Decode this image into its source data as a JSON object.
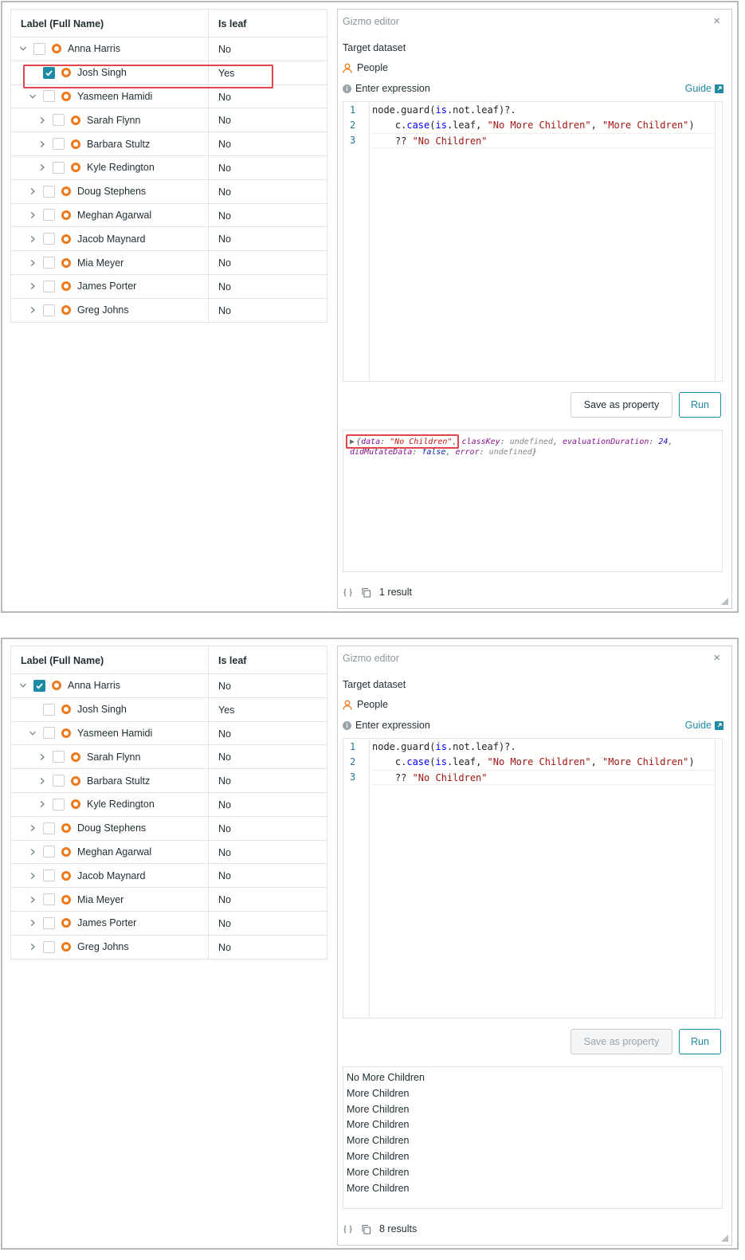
{
  "table": {
    "col_label": "Label (Full Name)",
    "col_leaf": "Is leaf"
  },
  "shot1": {
    "rows": [
      {
        "label": "Anna Harris",
        "leaf": "No",
        "level": 0,
        "chev": "down",
        "checked": false
      },
      {
        "label": "Josh Singh",
        "leaf": "Yes",
        "level": 1,
        "chev": "none",
        "checked": true
      },
      {
        "label": "Yasmeen Hamidi",
        "leaf": "No",
        "level": 1,
        "chev": "down",
        "checked": false
      },
      {
        "label": "Sarah Flynn",
        "leaf": "No",
        "level": 2,
        "chev": "right",
        "checked": false
      },
      {
        "label": "Barbara Stultz",
        "leaf": "No",
        "level": 2,
        "chev": "right",
        "checked": false
      },
      {
        "label": "Kyle Redington",
        "leaf": "No",
        "level": 2,
        "chev": "right",
        "checked": false
      },
      {
        "label": "Doug Stephens",
        "leaf": "No",
        "level": 1,
        "chev": "right",
        "checked": false
      },
      {
        "label": "Meghan Agarwal",
        "leaf": "No",
        "level": 1,
        "chev": "right",
        "checked": false
      },
      {
        "label": "Jacob Maynard",
        "leaf": "No",
        "level": 1,
        "chev": "right",
        "checked": false
      },
      {
        "label": "Mia Meyer",
        "leaf": "No",
        "level": 1,
        "chev": "right",
        "checked": false
      },
      {
        "label": "James Porter",
        "leaf": "No",
        "level": 1,
        "chev": "right",
        "checked": false
      },
      {
        "label": "Greg Johns",
        "leaf": "No",
        "level": 1,
        "chev": "right",
        "checked": false
      }
    ],
    "console": {
      "open": "{",
      "data_key": "data",
      "data_val": "\"No Children\"",
      "classkey_key": "classKey",
      "classkey_val": "undefined",
      "dur_key": "evaluationDuration",
      "dur_val": "24",
      "mut_key": "didMutateData",
      "mut_val": "false",
      "err_key": "error",
      "err_val": "undefined",
      "close": "}"
    },
    "result_count": "1 result"
  },
  "shot2": {
    "rows": [
      {
        "label": "Anna Harris",
        "leaf": "No",
        "level": 0,
        "chev": "down",
        "checked": true
      },
      {
        "label": "Josh Singh",
        "leaf": "Yes",
        "level": 1,
        "chev": "none",
        "checked": false
      },
      {
        "label": "Yasmeen Hamidi",
        "leaf": "No",
        "level": 1,
        "chev": "down",
        "checked": false
      },
      {
        "label": "Sarah Flynn",
        "leaf": "No",
        "level": 2,
        "chev": "right",
        "checked": false
      },
      {
        "label": "Barbara Stultz",
        "leaf": "No",
        "level": 2,
        "chev": "right",
        "checked": false
      },
      {
        "label": "Kyle Redington",
        "leaf": "No",
        "level": 2,
        "chev": "right",
        "checked": false
      },
      {
        "label": "Doug Stephens",
        "leaf": "No",
        "level": 1,
        "chev": "right",
        "checked": false
      },
      {
        "label": "Meghan Agarwal",
        "leaf": "No",
        "level": 1,
        "chev": "right",
        "checked": false
      },
      {
        "label": "Jacob Maynard",
        "leaf": "No",
        "level": 1,
        "chev": "right",
        "checked": false
      },
      {
        "label": "Mia Meyer",
        "leaf": "No",
        "level": 1,
        "chev": "right",
        "checked": false
      },
      {
        "label": "James Porter",
        "leaf": "No",
        "level": 1,
        "chev": "right",
        "checked": false
      },
      {
        "label": "Greg Johns",
        "leaf": "No",
        "level": 1,
        "chev": "right",
        "checked": false
      }
    ],
    "results": [
      "No More Children",
      "More Children",
      "More Children",
      "More Children",
      "More Children",
      "More Children",
      "More Children",
      "More Children"
    ],
    "result_count": "8 results"
  },
  "editor": {
    "title": "Gizmo editor",
    "close_glyph": "×",
    "target_label": "Target dataset",
    "dataset": "People",
    "expr_label": "Enter expression",
    "info_glyph": "i",
    "guide": "Guide",
    "line_numbers": [
      "1",
      "2",
      "3"
    ],
    "code": [
      [
        {
          "t": "node.guard(",
          "c": ""
        },
        {
          "t": "is",
          "c": "kw"
        },
        {
          "t": ".not.leaf)?.",
          "c": ""
        }
      ],
      [
        {
          "t": "    c.",
          "c": ""
        },
        {
          "t": "case",
          "c": "kw"
        },
        {
          "t": "(",
          "c": ""
        },
        {
          "t": "is",
          "c": "kw"
        },
        {
          "t": ".leaf, ",
          "c": ""
        },
        {
          "t": "\"No More Children\"",
          "c": "str"
        },
        {
          "t": ", ",
          "c": ""
        },
        {
          "t": "\"More Children\"",
          "c": "str"
        },
        {
          "t": ")",
          "c": ""
        }
      ],
      [
        {
          "t": "    ?? ",
          "c": ""
        },
        {
          "t": "\"No Children\"",
          "c": "str"
        }
      ]
    ],
    "save_label": "Save as property",
    "run_label": "Run"
  },
  "colors": {
    "accent": "#1e8aa3",
    "node_ring": "#ec7a1c",
    "highlight": "#e2464a"
  },
  "icons": {
    "close": "close-icon",
    "person": "person-icon",
    "info": "info-icon",
    "external": "external-link-icon",
    "braces": "braces-icon",
    "copy": "copy-icon",
    "chevron_down": "chevron-down-icon",
    "chevron_right": "chevron-right-icon",
    "check": "checkmark-icon",
    "node": "node-ring-icon"
  }
}
